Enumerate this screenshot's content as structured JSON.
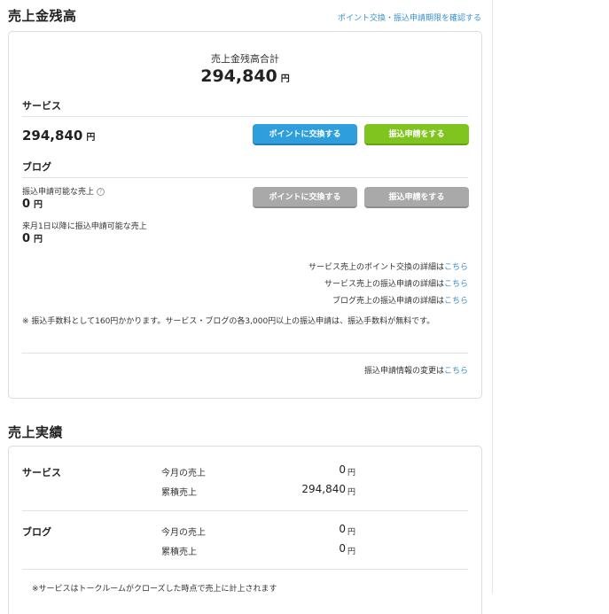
{
  "balance_section": {
    "title": "売上金残高",
    "link": "ポイント交換・振込申請期限を確認する",
    "total_label": "売上金残高合計",
    "total_value": "294,840",
    "yen": "円",
    "service": {
      "heading": "サービス",
      "amount": "294,840",
      "yen": "円",
      "exchange_button": "ポイントに交換する",
      "transfer_button": "振込申請をする"
    },
    "blog": {
      "heading": "ブログ",
      "transferable_label": "振込申請可能な売上",
      "transferable_amount": "0",
      "yen": "円",
      "future_label": "来月1日以降に振込申請可能な売上",
      "future_amount": "0",
      "exchange_button": "ポイントに交換する",
      "transfer_button": "振込申請をする"
    },
    "details": [
      {
        "text": "サービス売上のポイント交換の詳細は",
        "link": "こちら"
      },
      {
        "text": "サービス売上の振込申請の詳細は",
        "link": "こちら"
      },
      {
        "text": "ブログ売上の振込申請の詳細は",
        "link": "こちら"
      }
    ],
    "fee_note": "※ 振込手数料として160円かかります。サービス・ブログの各3,000円以上の振込申請は、振込手数料が無料です。",
    "change_info": {
      "text": "振込申請情報の変更は",
      "link": "こちら"
    }
  },
  "performance_section": {
    "title": "売上実績",
    "service": {
      "heading": "サービス",
      "rows": [
        {
          "label": "今月の売上",
          "value": "0",
          "unit": "円"
        },
        {
          "label": "累積売上",
          "value": "294,840",
          "unit": "円"
        }
      ]
    },
    "blog": {
      "heading": "ブログ",
      "rows": [
        {
          "label": "今月の売上",
          "value": "0",
          "unit": "円"
        },
        {
          "label": "累積売上",
          "value": "0",
          "unit": "円"
        }
      ]
    },
    "footnote": "※サービスはトークルームがクローズした時点で売上に計上されます"
  },
  "colors": {
    "link": "#3a8fc9",
    "exchange_button": "#2e9fdc",
    "transfer_button": "#7fc41f",
    "disabled_button": "#a9a9a9"
  }
}
